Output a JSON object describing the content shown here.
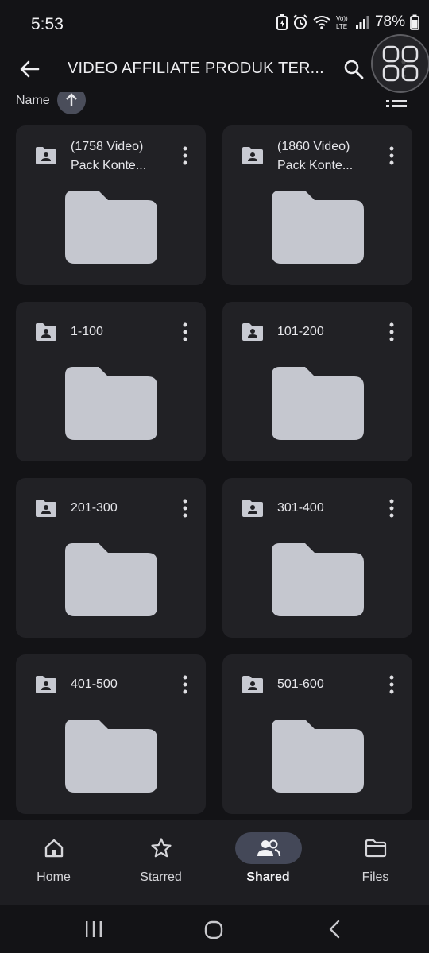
{
  "status_bar": {
    "time": "5:53",
    "battery": "78%"
  },
  "app_bar": {
    "title": "VIDEO AFFILIATE PRODUK TER..."
  },
  "sort": {
    "label": "Name"
  },
  "folders": [
    {
      "line1": "(1758 Video)",
      "line2": "Pack Konte..."
    },
    {
      "line1": "(1860 Video)",
      "line2": "Pack Konte..."
    },
    {
      "line1": "1-100",
      "line2": ""
    },
    {
      "line1": "101-200",
      "line2": ""
    },
    {
      "line1": "201-300",
      "line2": ""
    },
    {
      "line1": "301-400",
      "line2": ""
    },
    {
      "line1": "401-500",
      "line2": ""
    },
    {
      "line1": "501-600",
      "line2": ""
    }
  ],
  "bottom_nav": {
    "items": [
      {
        "label": "Home",
        "icon": "home-icon",
        "active": false
      },
      {
        "label": "Starred",
        "icon": "star-icon",
        "active": false
      },
      {
        "label": "Shared",
        "icon": "people-icon",
        "active": true
      },
      {
        "label": "Files",
        "icon": "folder-icon",
        "active": false
      }
    ]
  },
  "colors": {
    "background": "#131316",
    "card": "#212125",
    "folder_thumb": "#c5c7cf",
    "active_pill": "#444858"
  }
}
